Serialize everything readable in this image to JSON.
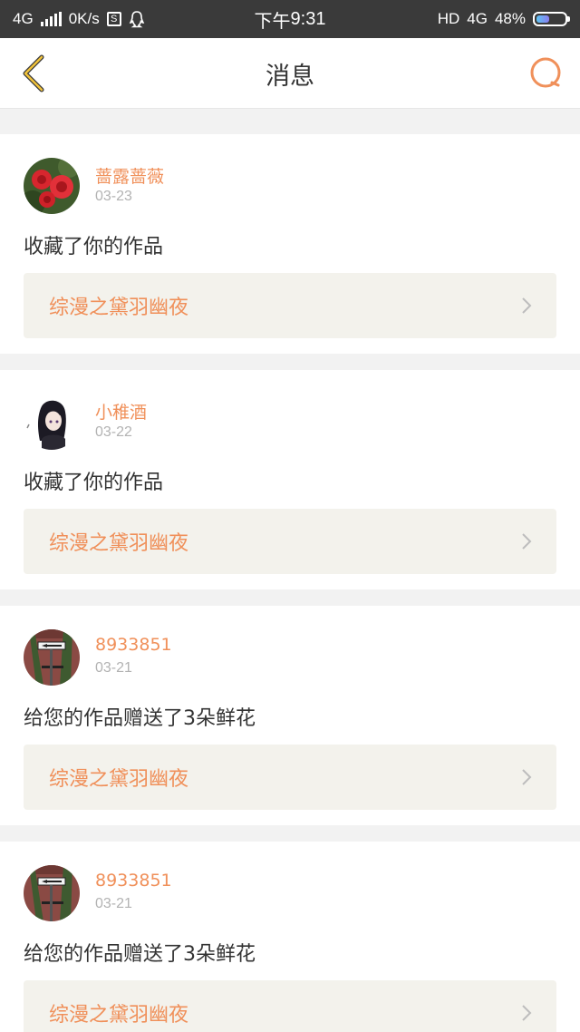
{
  "status_bar": {
    "network": "4G",
    "speed": "0K/s",
    "time_prefix": "下午",
    "time": "9:31",
    "hd": "HD",
    "network_right": "4G",
    "battery": "48%",
    "battery_level": 0.48
  },
  "nav": {
    "title": "消息"
  },
  "colors": {
    "accent": "#f0905a",
    "background": "#f2f2f2",
    "card_link_bg": "#f3f2ec",
    "text": "#333333",
    "muted": "#b3b3b3"
  },
  "notifications": [
    {
      "username": "蔷露蔷薇",
      "date": "03-23",
      "action": "收藏了你的作品",
      "work_title": "综漫之黛羽幽夜",
      "avatar": "red-flower-avatar"
    },
    {
      "username": "小稚酒",
      "date": "03-22",
      "action": "收藏了你的作品",
      "work_title": "综漫之黛羽幽夜",
      "avatar": "anime-girl-avatar"
    },
    {
      "username": "8933851",
      "date": "03-21",
      "action": "给您的作品赠送了3朵鲜花",
      "work_title": "综漫之黛羽幽夜",
      "avatar": "street-sign-avatar"
    },
    {
      "username": "8933851",
      "date": "03-21",
      "action": "给您的作品赠送了3朵鲜花",
      "work_title": "综漫之黛羽幽夜",
      "avatar": "street-sign-avatar"
    }
  ]
}
